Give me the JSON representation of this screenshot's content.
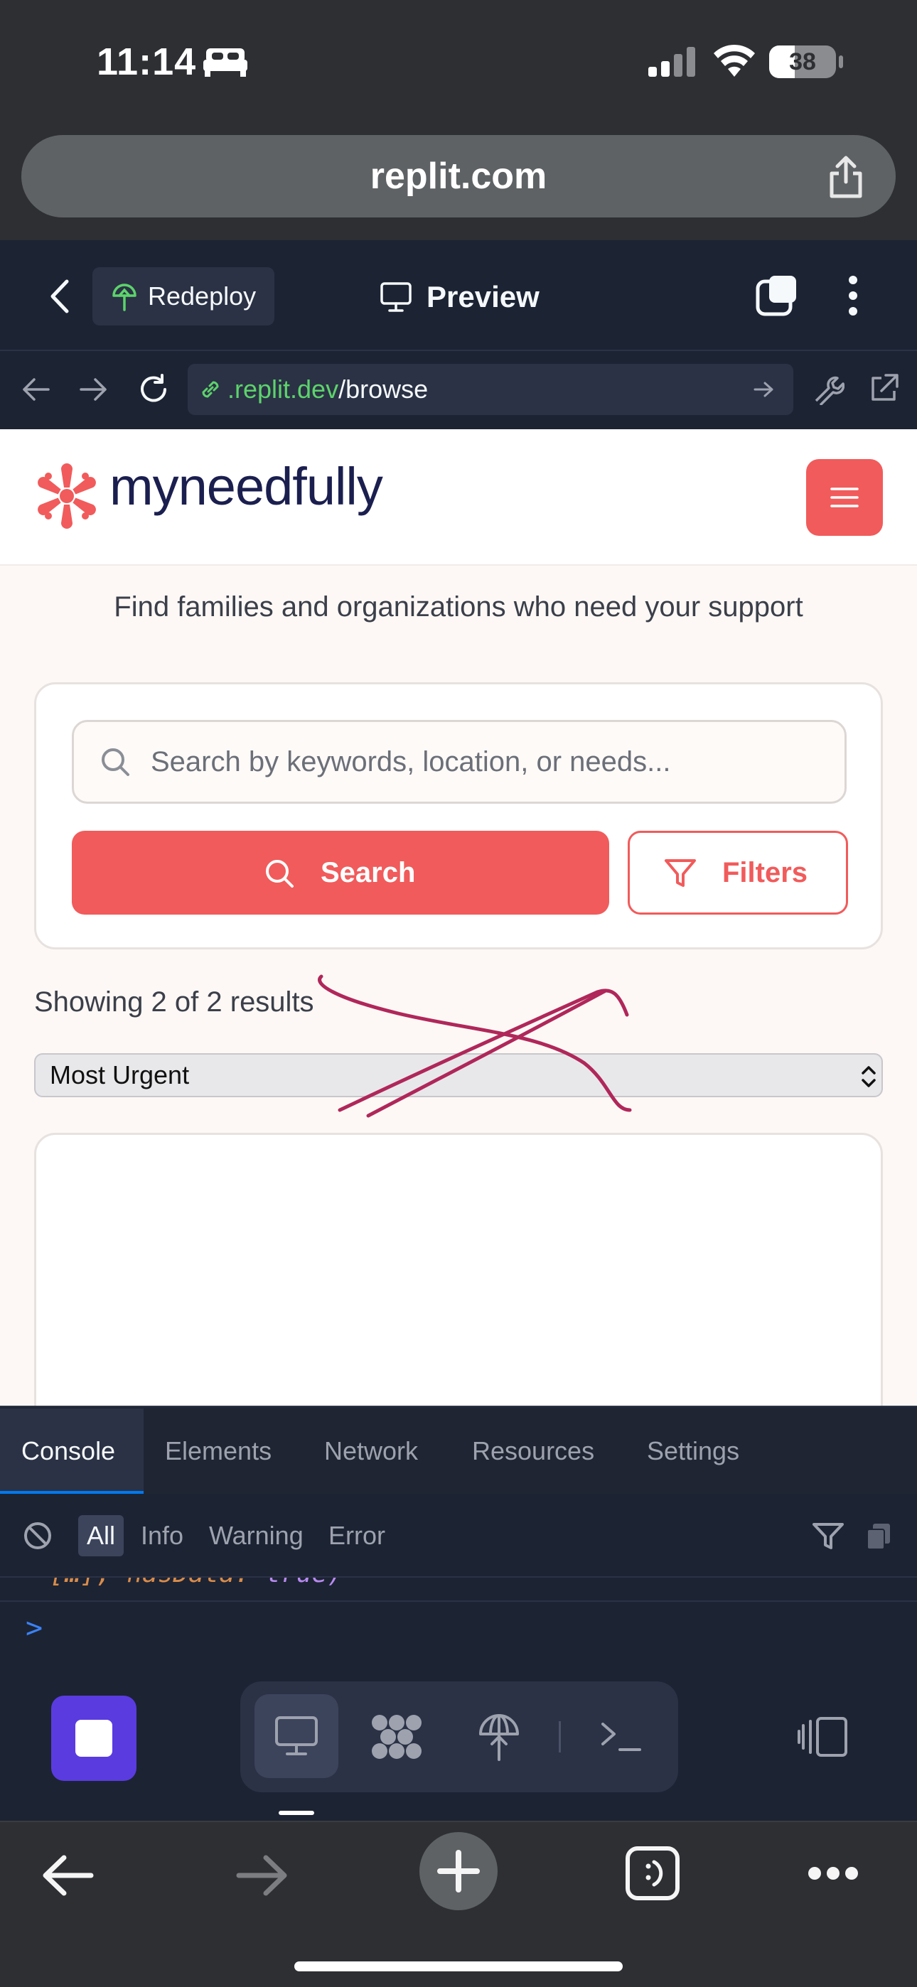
{
  "status_bar": {
    "time": "11:14",
    "battery": "38"
  },
  "browser": {
    "address": "replit.com"
  },
  "replit": {
    "redeploy_label": "Redeploy",
    "preview_label": "Preview",
    "url_host": ".replit.dev",
    "url_path": "/browse"
  },
  "site": {
    "brand": "myneedfully",
    "tagline": "Find families and organizations who need your support",
    "search_placeholder": "Search by keywords, location, or needs...",
    "search_button": "Search",
    "filters_button": "Filters",
    "results_text": "Showing 2 of 2 results",
    "sort_selected": "Most Urgent",
    "colors": {
      "accent": "#f15b5b",
      "brand_text": "#1b1f4f",
      "annotation": "#b0275a"
    }
  },
  "devtools": {
    "tabs": [
      "Console",
      "Elements",
      "Network",
      "Resources",
      "Settings"
    ],
    "levels": [
      "All",
      "Info",
      "Warning",
      "Error"
    ],
    "log_text": "[…], hasData: ",
    "log_value": "true)",
    "prompt": ">"
  }
}
